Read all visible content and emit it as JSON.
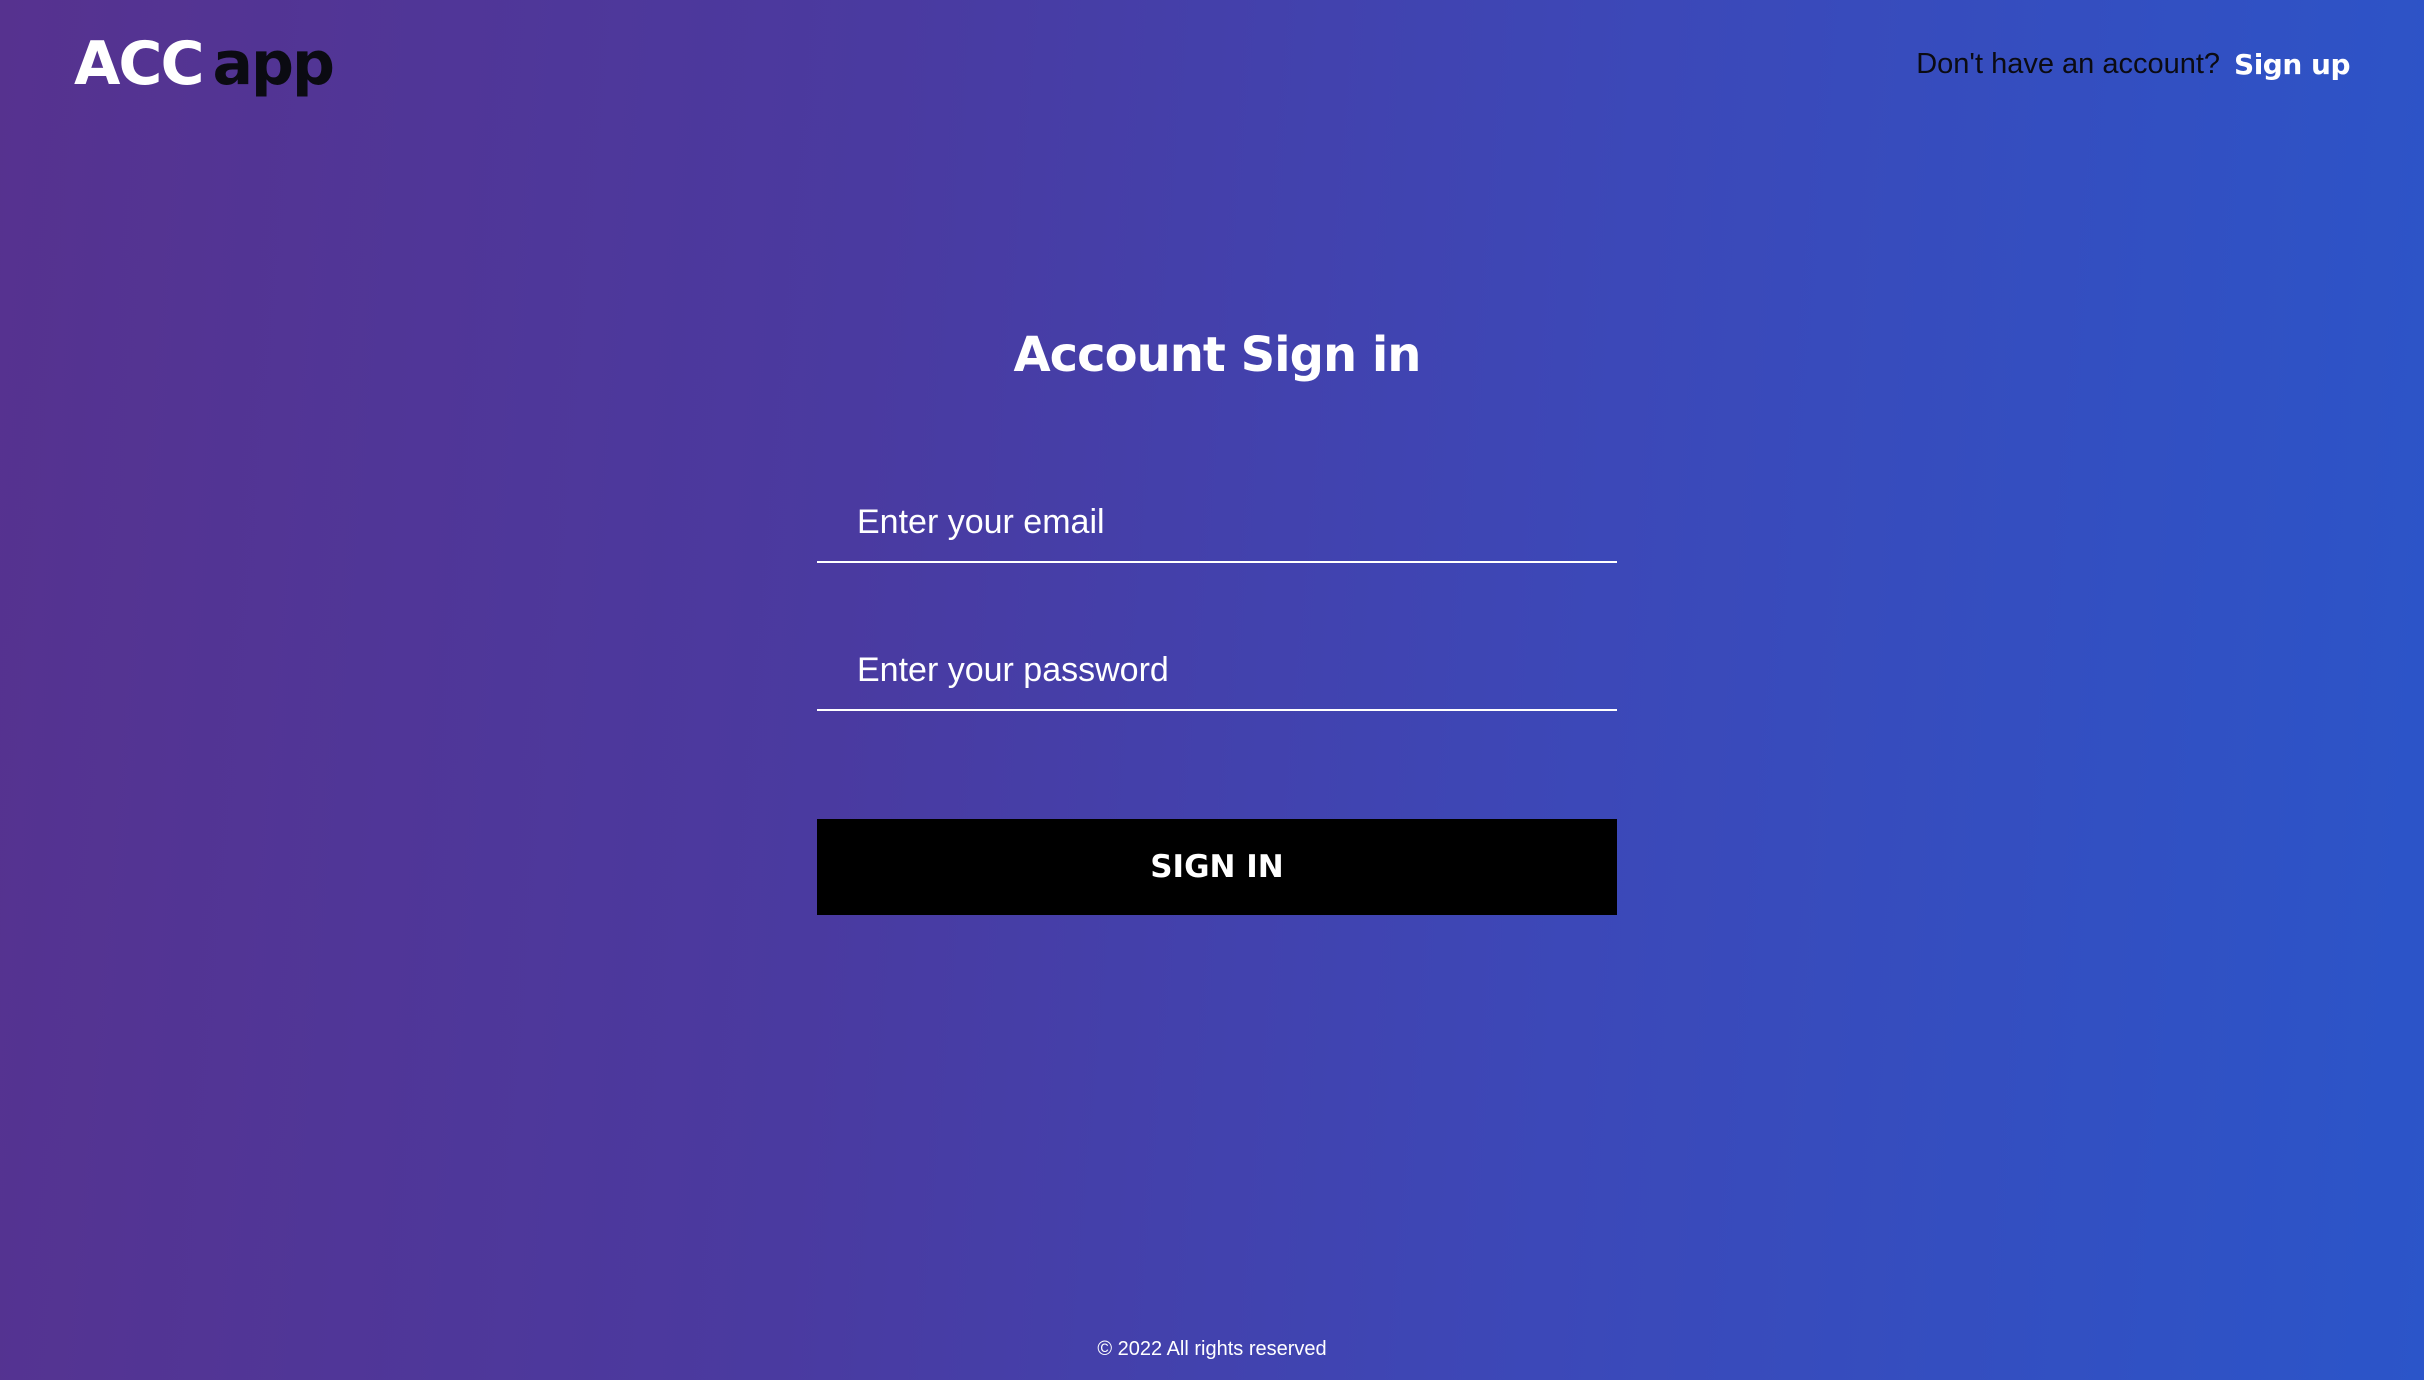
{
  "brand": {
    "logo_part1": "ACC",
    "logo_part2": "app"
  },
  "header": {
    "signup_prompt": "Don't have an account?",
    "signup_link": "Sign up"
  },
  "form": {
    "title": "Account Sign in",
    "email_placeholder": "Enter your email",
    "email_value": "",
    "password_placeholder": "Enter your password",
    "password_value": "",
    "submit_label": "SIGN IN"
  },
  "footer": {
    "copyright": "© 2022 All rights reserved"
  },
  "colors": {
    "gradient_start": "#56328f",
    "gradient_end": "#2b55c9",
    "button_bg": "#000000",
    "text_light": "#ffffff",
    "text_dark": "#0b0b12"
  }
}
